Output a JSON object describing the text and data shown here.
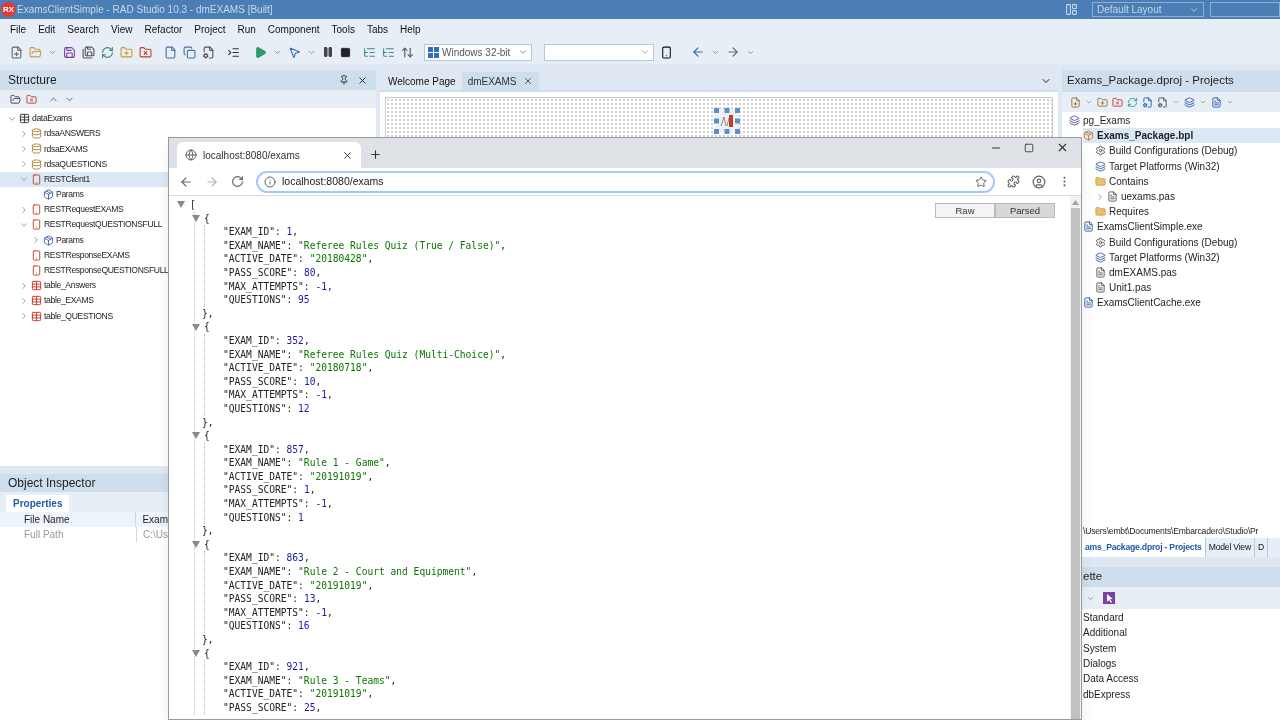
{
  "title_bar": {
    "app_icon_text": "RX",
    "title": "ExamsClientSimple - RAD Studio 10.3 - dmEXAMS [Built]",
    "layout": "Default Layout"
  },
  "menu": [
    "File",
    "Edit",
    "Search",
    "View",
    "Refactor",
    "Project",
    "Run",
    "Component",
    "Tools",
    "Tabs",
    "Help"
  ],
  "toolbar": {
    "platform": "Windows 32-bit"
  },
  "structure": {
    "title": "Structure",
    "tree": [
      {
        "label": "dataExams",
        "kind": "module",
        "expanded": true,
        "selected": false,
        "children": [
          {
            "label": "rdsaANSWERS",
            "kind": "dataset",
            "expanded": false,
            "selected": false
          },
          {
            "label": "rdsaEXAMS",
            "kind": "dataset",
            "expanded": false,
            "selected": false
          },
          {
            "label": "rdsaQUESTIONS",
            "kind": "dataset",
            "expanded": false,
            "selected": false
          },
          {
            "label": "RESTClient1",
            "kind": "rest",
            "expanded": true,
            "selected": true,
            "children": [
              {
                "label": "Params",
                "kind": "params",
                "selected": false
              }
            ]
          },
          {
            "label": "RESTRequestEXAMS",
            "kind": "rest",
            "expanded": false,
            "selected": false
          },
          {
            "label": "RESTRequestQUESTIONSFULL",
            "kind": "rest",
            "expanded": true,
            "selected": false,
            "children": [
              {
                "label": "Params",
                "kind": "params",
                "expanded": false,
                "selected": false
              }
            ]
          },
          {
            "label": "RESTResponseEXAMS",
            "kind": "rest",
            "selected": false
          },
          {
            "label": "RESTResponseQUESTIONSFULL",
            "kind": "rest",
            "selected": false
          },
          {
            "label": "table_Answers",
            "kind": "table",
            "expanded": false,
            "selected": false
          },
          {
            "label": "table_EXAMS",
            "kind": "table",
            "expanded": false,
            "selected": false
          },
          {
            "label": "table_QUESTIONS",
            "kind": "table",
            "expanded": false,
            "selected": false
          }
        ]
      }
    ]
  },
  "object_inspector": {
    "title": "Object Inspector",
    "tabs": [
      {
        "label": "Properties",
        "selected": true
      }
    ],
    "rows": [
      {
        "name": "File Name",
        "value": "Exam",
        "disabled": false
      },
      {
        "name": "Full Path",
        "value": "C:\\Us",
        "disabled": true
      }
    ]
  },
  "editor_tabs": [
    {
      "label": "Welcome Page",
      "selected": false
    },
    {
      "label": "dmEXAMS",
      "selected": true
    }
  ],
  "projects": {
    "title": "Exams_Package.dproj - Projects",
    "tree": [
      {
        "label": "pg_Exams",
        "kind": "group",
        "selected": false,
        "children": [
          {
            "label": "Exams_Package.bpl",
            "kind": "package",
            "selected": true,
            "children": [
              {
                "label": "Build Configurations (Debug)",
                "kind": "config",
                "selected": false
              },
              {
                "label": "Target Platforms (Win32)",
                "kind": "platforms",
                "selected": false
              },
              {
                "label": "Contains",
                "kind": "folder",
                "selected": false,
                "children": [
                  {
                    "label": "uexams.pas",
                    "kind": "file",
                    "expanded": false,
                    "selected": false
                  }
                ]
              },
              {
                "label": "Requires",
                "kind": "folder",
                "selected": false
              }
            ]
          },
          {
            "label": "ExamsClientSimple.exe",
            "kind": "exe",
            "selected": false,
            "children": [
              {
                "label": "Build Configurations (Debug)",
                "kind": "config",
                "selected": false
              },
              {
                "label": "Target Platforms (Win32)",
                "kind": "platforms",
                "selected": false
              },
              {
                "label": "dmEXAMS.pas",
                "kind": "file",
                "selected": false
              },
              {
                "label": "Unit1.pas",
                "kind": "file",
                "selected": false
              }
            ]
          },
          {
            "label": "ExamsClientCache.exe",
            "kind": "exe",
            "selected": false
          }
        ]
      }
    ]
  },
  "path": "\\Users\\embt\\Documents\\Embarcadero\\Studio\\Pr",
  "bottom_tabs": [
    {
      "label": "ams_Package.dproj - Projects",
      "selected": true
    },
    {
      "label": "Model View",
      "selected": false
    },
    {
      "label": "D",
      "selected": false
    }
  ],
  "palette": {
    "title": "ette",
    "categories": [
      "Standard",
      "Additional",
      "System",
      "Dialogs",
      "Data Access",
      "dbExpress"
    ]
  },
  "browser": {
    "tab_title": "localhost:8080/exams",
    "url": "localhost:8080/exams",
    "view_buttons": [
      {
        "label": "Raw",
        "selected": false
      },
      {
        "label": "Parsed",
        "selected": true
      }
    ],
    "json": {
      "open": "[",
      "expanded": true,
      "items": [
        {
          "expanded": true,
          "open": "{",
          "close": "},",
          "lines": [
            {
              "key": "\"EXAM_ID\":",
              "value": "1",
              "kind": "number",
              "end": ","
            },
            {
              "key": "\"EXAM_NAME\":",
              "value": "\"Referee Rules Quiz (True / False)\"",
              "kind": "string",
              "end": ","
            },
            {
              "key": "\"ACTIVE_DATE\":",
              "value": "\"20180428\"",
              "kind": "string",
              "end": ","
            },
            {
              "key": "\"PASS_SCORE\":",
              "value": "80",
              "kind": "number",
              "end": ","
            },
            {
              "key": "\"MAX_ATTEMPTS\":",
              "value": "-1",
              "kind": "number",
              "end": ","
            },
            {
              "key": "\"QUESTIONS\":",
              "value": "95",
              "kind": "number"
            }
          ]
        },
        {
          "expanded": true,
          "open": "{",
          "close": "},",
          "lines": [
            {
              "key": "\"EXAM_ID\":",
              "value": "352",
              "kind": "number",
              "end": ","
            },
            {
              "key": "\"EXAM_NAME\":",
              "value": "\"Referee Rules Quiz (Multi-Choice)\"",
              "kind": "string",
              "end": ","
            },
            {
              "key": "\"ACTIVE_DATE\":",
              "value": "\"20180718\"",
              "kind": "string",
              "end": ","
            },
            {
              "key": "\"PASS_SCORE\":",
              "value": "10",
              "kind": "number",
              "end": ","
            },
            {
              "key": "\"MAX_ATTEMPTS\":",
              "value": "-1",
              "kind": "number",
              "end": ","
            },
            {
              "key": "\"QUESTIONS\":",
              "value": "12",
              "kind": "number"
            }
          ]
        },
        {
          "expanded": true,
          "open": "{",
          "close": "},",
          "lines": [
            {
              "key": "\"EXAM_ID\":",
              "value": "857",
              "kind": "number",
              "end": ","
            },
            {
              "key": "\"EXAM_NAME\":",
              "value": "\"Rule 1 - Game\"",
              "kind": "string",
              "end": ","
            },
            {
              "key": "\"ACTIVE_DATE\":",
              "value": "\"20191019\"",
              "kind": "string",
              "end": ","
            },
            {
              "key": "\"PASS_SCORE\":",
              "value": "1",
              "kind": "number",
              "end": ","
            },
            {
              "key": "\"MAX_ATTEMPTS\":",
              "value": "-1",
              "kind": "number",
              "end": ","
            },
            {
              "key": "\"QUESTIONS\":",
              "value": "1",
              "kind": "number"
            }
          ]
        },
        {
          "expanded": true,
          "open": "{",
          "close": "},",
          "lines": [
            {
              "key": "\"EXAM_ID\":",
              "value": "863",
              "kind": "number",
              "end": ","
            },
            {
              "key": "\"EXAM_NAME\":",
              "value": "\"Rule 2 - Court and Equipment\"",
              "kind": "string",
              "end": ","
            },
            {
              "key": "\"ACTIVE_DATE\":",
              "value": "\"20191019\"",
              "kind": "string",
              "end": ","
            },
            {
              "key": "\"PASS_SCORE\":",
              "value": "13",
              "kind": "number",
              "end": ","
            },
            {
              "key": "\"MAX_ATTEMPTS\":",
              "value": "-1",
              "kind": "number",
              "end": ","
            },
            {
              "key": "\"QUESTIONS\":",
              "value": "16",
              "kind": "number"
            }
          ]
        },
        {
          "expanded": true,
          "open": "{",
          "lines": [
            {
              "key": "\"EXAM_ID\":",
              "value": "921",
              "kind": "number",
              "end": ","
            },
            {
              "key": "\"EXAM_NAME\":",
              "value": "\"Rule 3 - Teams\"",
              "kind": "string",
              "end": ","
            },
            {
              "key": "\"ACTIVE_DATE\":",
              "value": "\"20191019\"",
              "kind": "string",
              "end": ","
            },
            {
              "key": "\"PASS_SCORE\":",
              "value": "25",
              "kind": "number",
              "end": ","
            }
          ]
        }
      ]
    }
  }
}
